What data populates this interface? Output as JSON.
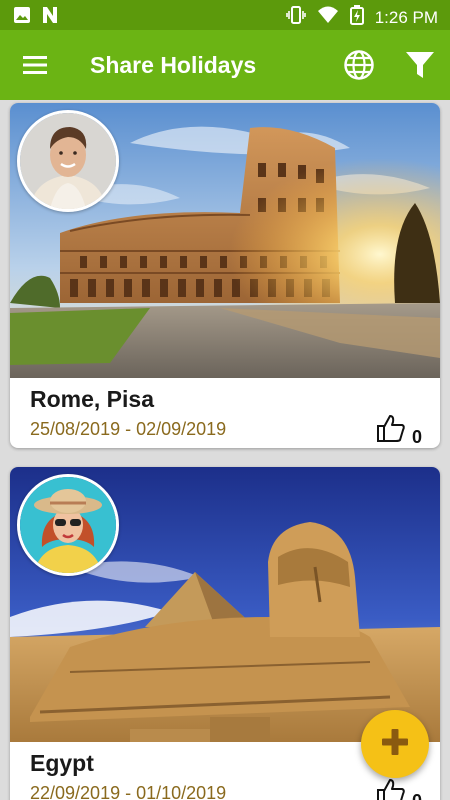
{
  "status_bar": {
    "time": "1:26 PM",
    "icons": [
      "image-icon",
      "n-icon",
      "vibrate-icon",
      "wifi-icon",
      "battery-charging-icon"
    ]
  },
  "app_bar": {
    "title": "Share Holidays",
    "menu_icon": "hamburger-menu-icon",
    "actions": [
      "globe-icon",
      "filter-icon"
    ]
  },
  "feed": {
    "posts": [
      {
        "place": "Rome, Pisa",
        "dates": "25/08/2019 - 02/09/2019",
        "likes": "0",
        "photo": "colosseum-photo",
        "avatar": "man-avatar"
      },
      {
        "place": "Egypt",
        "dates": "22/09/2019 - 01/10/2019",
        "likes": "0",
        "photo": "sphinx-photo",
        "avatar": "woman-avatar"
      }
    ]
  },
  "fab": {
    "icon": "plus-icon"
  },
  "colors": {
    "status_bar": "#5c9a0c",
    "app_bar": "#6bb414",
    "fab": "#f5c116",
    "dates": "#8a6a1e"
  }
}
